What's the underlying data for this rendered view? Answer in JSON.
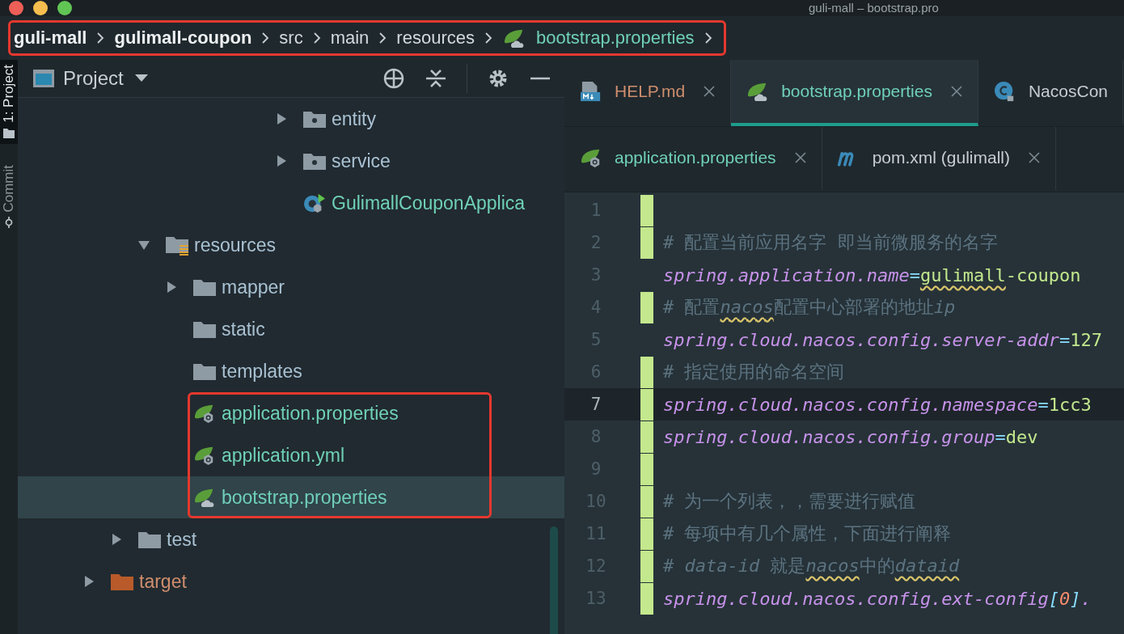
{
  "window": {
    "title": "guli-mall – bootstrap.pro"
  },
  "breadcrumb": {
    "highlighted": true,
    "items": [
      {
        "label": "guli-mall",
        "kind": "module"
      },
      {
        "label": "gulimall-coupon",
        "kind": "module"
      },
      {
        "label": "src",
        "kind": "folder"
      },
      {
        "label": "main",
        "kind": "folder"
      },
      {
        "label": "resources",
        "kind": "folder"
      },
      {
        "label": "bootstrap.properties",
        "kind": "file"
      }
    ]
  },
  "tool_stripe": [
    {
      "label": "1: Project",
      "kind": "project",
      "selected": true
    },
    {
      "label": "Commit",
      "kind": "commit",
      "selected": false
    }
  ],
  "project_panel": {
    "title": "Project"
  },
  "tree": [
    {
      "children": [
        {
          "children": [
            {
              "children": [
                {
                  "children": [
                    {
                      "children": [
                        {
                          "children": [
                            {
                              "children": [
                                {
                                  "label": "entity",
                                  "kind": "package",
                                  "color": "#a9c2d3",
                                  "expanded": false,
                                  "selected": false,
                                  "highlighted": false
                                },
                                {
                                  "label": "service",
                                  "kind": "package",
                                  "color": "#a9c2d3",
                                  "expanded": false,
                                  "selected": false,
                                  "highlighted": false
                                },
                                {
                                  "label": "GulimallCouponApplica",
                                  "kind": "boot-class",
                                  "color": "#6fd0b8",
                                  "selected": false,
                                  "highlighted": false
                                }
                              ]
                            }
                          ]
                        }
                      ]
                    }
                  ]
                }
              ]
            },
            {
              "label": "resources",
              "kind": "resources-folder",
              "color": "#a9c2d3",
              "expanded": true,
              "selected": false,
              "highlighted": false,
              "children": [
                {
                  "label": "mapper",
                  "kind": "folder",
                  "color": "#a9c2d3",
                  "expanded": false,
                  "selected": false,
                  "highlighted": false
                },
                {
                  "label": "static",
                  "kind": "folder",
                  "color": "#a9c2d3",
                  "selected": false,
                  "highlighted": false
                },
                {
                  "label": "templates",
                  "kind": "folder",
                  "color": "#a9c2d3",
                  "selected": false,
                  "highlighted": false
                },
                {
                  "label": "application.properties",
                  "kind": "spring-config",
                  "color": "#6fd0b8",
                  "selected": false,
                  "highlighted": true
                },
                {
                  "label": "application.yml",
                  "kind": "spring-config",
                  "color": "#6fd0b8",
                  "selected": false,
                  "highlighted": true
                },
                {
                  "label": "bootstrap.properties",
                  "kind": "spring-bootstrap",
                  "color": "#6fd0b8",
                  "selected": true,
                  "highlighted": true
                }
              ]
            }
          ]
        },
        {
          "label": "test",
          "kind": "folder",
          "color": "#a9c2d3",
          "expanded": false,
          "selected": false,
          "highlighted": false
        }
      ]
    },
    {
      "label": "target",
      "kind": "excluded-folder",
      "color": "#cf8e6d",
      "expanded": false,
      "selected": false,
      "highlighted": false
    }
  ],
  "editor_tabs": [
    [
      {
        "label": "HELP.md",
        "kind": "markdown",
        "color": "#cf8e6d",
        "selected": false,
        "closable": true
      },
      {
        "label": "bootstrap.properties",
        "kind": "spring-bootstrap",
        "color": "#6fd0b8",
        "selected": true,
        "closable": true
      },
      {
        "label": "NacosCon",
        "kind": "class",
        "color": "#c7cdd1",
        "selected": false,
        "closable": false
      }
    ],
    [
      {
        "label": "application.properties",
        "kind": "spring-config",
        "color": "#6fd0b8",
        "selected": false,
        "closable": true
      },
      {
        "label": "pom.xml (gulimall)",
        "kind": "maven",
        "color": "#c7cdd1",
        "selected": false,
        "closable": true
      }
    ]
  ],
  "code_lines": [
    {
      "number": "1",
      "changed": true,
      "current": false
    },
    {
      "number": "2",
      "changed": true,
      "current": false,
      "segments": [
        {
          "t": "# 配置当前应用名字 即当前微服务的名字",
          "kind": "comment",
          "squiggle": false
        }
      ]
    },
    {
      "number": "3",
      "changed": false,
      "current": false,
      "segments": [
        {
          "t": "spring.application.name",
          "kind": "key",
          "squiggle": false
        },
        {
          "t": "=",
          "kind": "eq",
          "squiggle": false
        },
        {
          "t": "gulimall",
          "kind": "value",
          "squiggle": true
        },
        {
          "t": "-coupon",
          "kind": "value",
          "squiggle": false
        }
      ]
    },
    {
      "number": "4",
      "changed": true,
      "current": false,
      "segments": [
        {
          "t": "# 配置",
          "kind": "comment",
          "squiggle": false
        },
        {
          "t": "nacos",
          "kind": "comment-ref",
          "squiggle": true
        },
        {
          "t": "配置中心部署的地址",
          "kind": "comment",
          "squiggle": false
        },
        {
          "t": "ip",
          "kind": "comment-ref",
          "squiggle": false
        }
      ]
    },
    {
      "number": "5",
      "changed": false,
      "current": false,
      "segments": [
        {
          "t": "spring.cloud.nacos.config.server-addr",
          "kind": "key",
          "squiggle": false
        },
        {
          "t": "=",
          "kind": "eq",
          "squiggle": false
        },
        {
          "t": "127",
          "kind": "value",
          "squiggle": false
        }
      ]
    },
    {
      "number": "6",
      "changed": true,
      "current": false,
      "segments": [
        {
          "t": "# 指定使用的命名空间",
          "kind": "comment",
          "squiggle": false
        }
      ]
    },
    {
      "number": "7",
      "changed": true,
      "current": true,
      "segments": [
        {
          "t": "spring.cloud.nacos.config.namespace",
          "kind": "key",
          "squiggle": false
        },
        {
          "t": "=",
          "kind": "eq",
          "squiggle": false
        },
        {
          "t": "1cc3",
          "kind": "value",
          "squiggle": false
        }
      ]
    },
    {
      "number": "8",
      "changed": true,
      "current": false,
      "segments": [
        {
          "t": "spring.cloud.nacos.config.group",
          "kind": "key",
          "squiggle": false
        },
        {
          "t": "=",
          "kind": "eq",
          "squiggle": false
        },
        {
          "t": "dev",
          "kind": "value",
          "squiggle": false
        }
      ]
    },
    {
      "number": "9",
      "changed": true,
      "current": false
    },
    {
      "number": "10",
      "changed": true,
      "current": false,
      "segments": [
        {
          "t": "# 为一个列表，，需要进行赋值",
          "kind": "comment",
          "squiggle": false
        }
      ]
    },
    {
      "number": "11",
      "changed": true,
      "current": false,
      "segments": [
        {
          "t": "# 每项中有几个属性，下面进行阐释",
          "kind": "comment",
          "squiggle": false
        }
      ]
    },
    {
      "number": "12",
      "changed": true,
      "current": false,
      "segments": [
        {
          "t": "# ",
          "kind": "comment",
          "squiggle": false
        },
        {
          "t": "data-id",
          "kind": "comment-ref",
          "squiggle": false
        },
        {
          "t": " 就是",
          "kind": "comment",
          "squiggle": false
        },
        {
          "t": "nacos",
          "kind": "comment-ref",
          "squiggle": true
        },
        {
          "t": "中的",
          "kind": "comment",
          "squiggle": false
        },
        {
          "t": "dataid",
          "kind": "comment-ref",
          "squiggle": true
        }
      ]
    },
    {
      "number": "13",
      "changed": true,
      "current": false,
      "segments": [
        {
          "t": "spring.cloud.nacos.config.ext-config",
          "kind": "key",
          "squiggle": false
        },
        {
          "t": "[",
          "kind": "bracket",
          "squiggle": false
        },
        {
          "t": "0",
          "kind": "index",
          "squiggle": false
        },
        {
          "t": "]",
          "kind": "bracket",
          "squiggle": false
        },
        {
          "t": ".",
          "kind": "key",
          "squiggle": false
        }
      ]
    }
  ]
}
